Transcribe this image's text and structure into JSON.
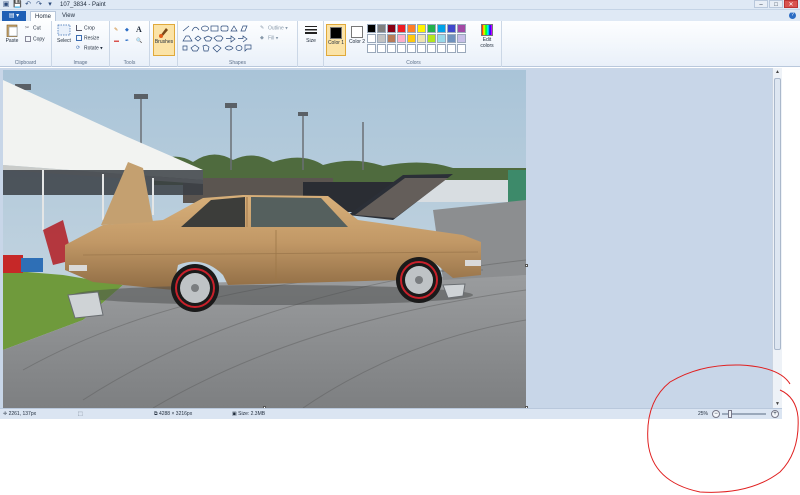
{
  "window": {
    "title": "107_3834 - Paint",
    "controls": [
      "–",
      "□",
      "✕"
    ]
  },
  "qat_icons": [
    "save-icon",
    "undo-icon",
    "redo-icon",
    "customize-icon"
  ],
  "tabs": {
    "file": "",
    "home": "Home",
    "view": "View"
  },
  "ribbon": {
    "clipboard": {
      "label": "Clipboard",
      "paste": "Paste",
      "cut": "Cut",
      "copy": "Copy"
    },
    "image": {
      "label": "Image",
      "select": "Select",
      "crop": "Crop",
      "resize": "Resize",
      "rotate": "Rotate ▾"
    },
    "tools": {
      "label": "Tools"
    },
    "brushes": {
      "label": "Brushes"
    },
    "shapes": {
      "label": "Shapes",
      "outline": "Outline ▾",
      "fill": "Fill ▾"
    },
    "size": {
      "label": "Size"
    },
    "color1": {
      "label": "Color 1"
    },
    "color2": {
      "label": "Color 2"
    },
    "colors": {
      "label": "Colors",
      "edit": "Edit colors"
    }
  },
  "palette": [
    "#000000",
    "#7f7f7f",
    "#880015",
    "#ed1c24",
    "#ff7f27",
    "#fff200",
    "#22b14c",
    "#00a2e8",
    "#3f48cc",
    "#a349a4",
    "#ffffff",
    "#c3c3c3",
    "#b97a57",
    "#ffaec9",
    "#ffc90e",
    "#efe4b0",
    "#b5e61d",
    "#99d9ea",
    "#7092be",
    "#c8bfe7",
    "#ffffff",
    "#ffffff",
    "#ffffff",
    "#ffffff",
    "#ffffff",
    "#ffffff",
    "#ffffff",
    "#ffffff",
    "#ffffff",
    "#ffffff"
  ],
  "colors_selected": {
    "color1": "#000000",
    "color2": "#ffffff",
    "accent": "#f6c04a"
  },
  "status": {
    "cursor_pos": "2261, 137px",
    "dimensions": "4288 × 3216px",
    "size": "Size: 2.3MB",
    "zoom": "25%",
    "zoom_out": "−",
    "zoom_in": "+"
  },
  "scroll": {
    "up": "▲",
    "down": "▼"
  }
}
